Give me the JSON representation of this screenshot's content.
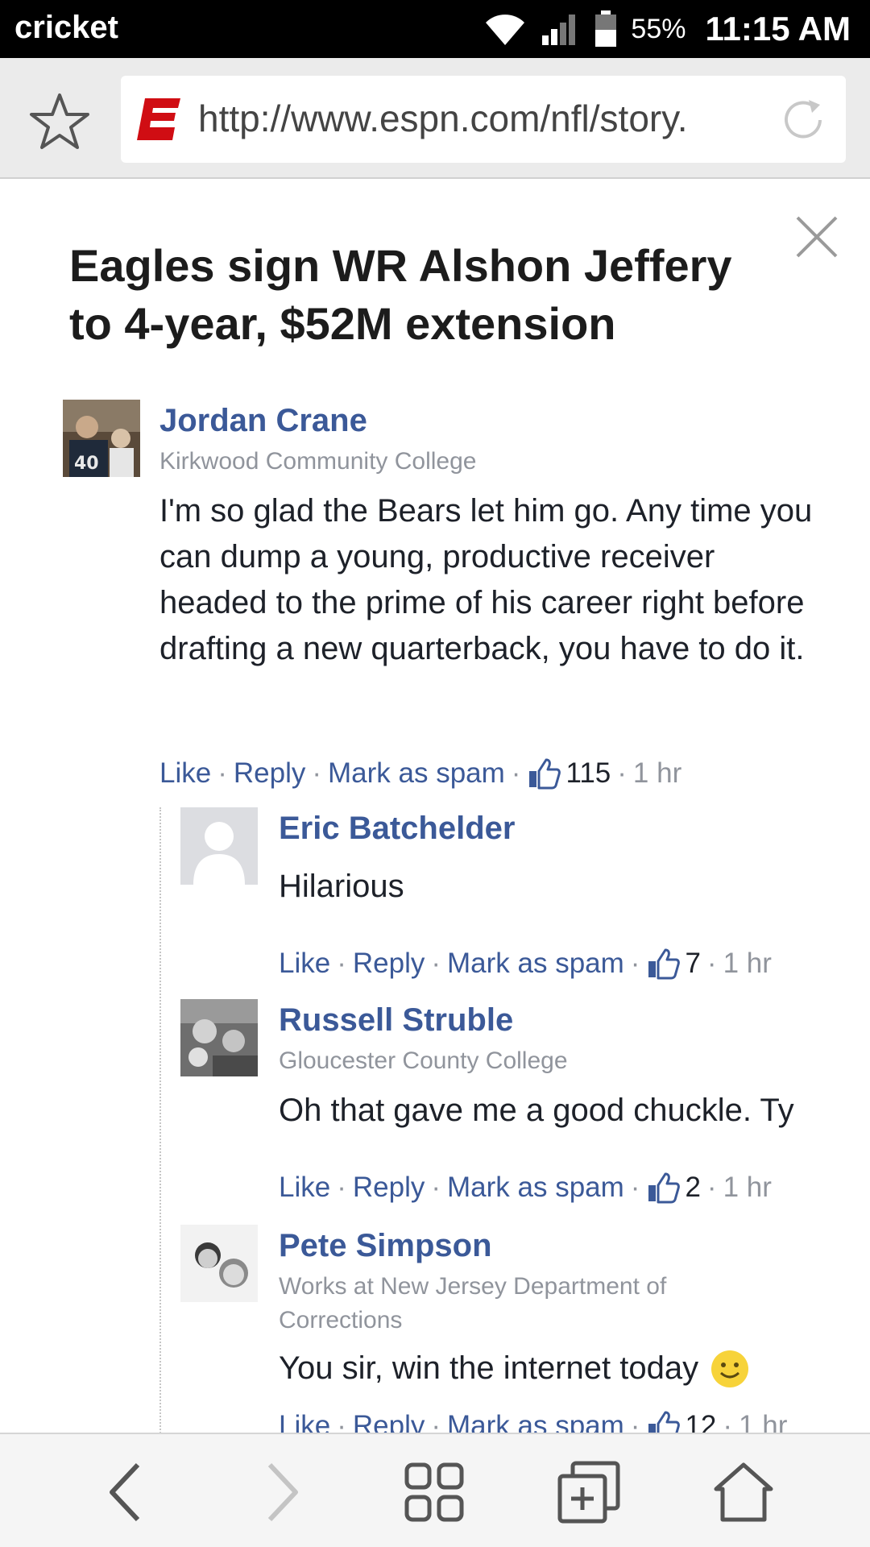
{
  "status_bar": {
    "carrier": "cricket",
    "battery": "55%",
    "time": "11:15 AM",
    "icons": [
      "wifi-icon",
      "signal-icon",
      "battery-icon"
    ]
  },
  "browser": {
    "url": "http://www.espn.com/nfl/story.",
    "icons": [
      "star-icon",
      "espn-logo-icon",
      "reload-icon"
    ],
    "accent_color": "#d00d13"
  },
  "article": {
    "title": "Eagles sign WR Alshon Jeffery to 4-year, $52M extension"
  },
  "comments": [
    {
      "name": "Jordan Crane",
      "affiliation": "Kirkwood Community College",
      "text": "I'm so glad the Bears let him go. Any time you can dump a young, productive receiver headed to the prime of his career right before drafting a new quarterback, you have to do it.",
      "like": "Like",
      "reply": "Reply",
      "spam": "Mark as spam",
      "likes": "115",
      "time": "1 hr"
    },
    {
      "name": "Eric Batchelder",
      "affiliation": "",
      "text": "Hilarious",
      "like": "Like",
      "reply": "Reply",
      "spam": "Mark as spam",
      "likes": "7",
      "time": "1 hr"
    },
    {
      "name": "Russell Struble",
      "affiliation": "Gloucester County College",
      "text": "Oh that gave me a good chuckle. Ty",
      "like": "Like",
      "reply": "Reply",
      "spam": "Mark as spam",
      "likes": "2",
      "time": "1 hr"
    },
    {
      "name": "Pete Simpson",
      "affiliation": "Works at New Jersey Department of Corrections",
      "text": "You sir, win the internet today",
      "like": "Like",
      "reply": "Reply",
      "spam": "Mark as spam",
      "likes": "12",
      "time": "1 hr"
    }
  ],
  "colors": {
    "link": "#3b5998",
    "meta": "#90949c",
    "text": "#1d2129"
  },
  "bottom_nav": {
    "icons": [
      "back-icon",
      "forward-icon",
      "apps-icon",
      "new-tab-icon",
      "home-icon"
    ]
  }
}
